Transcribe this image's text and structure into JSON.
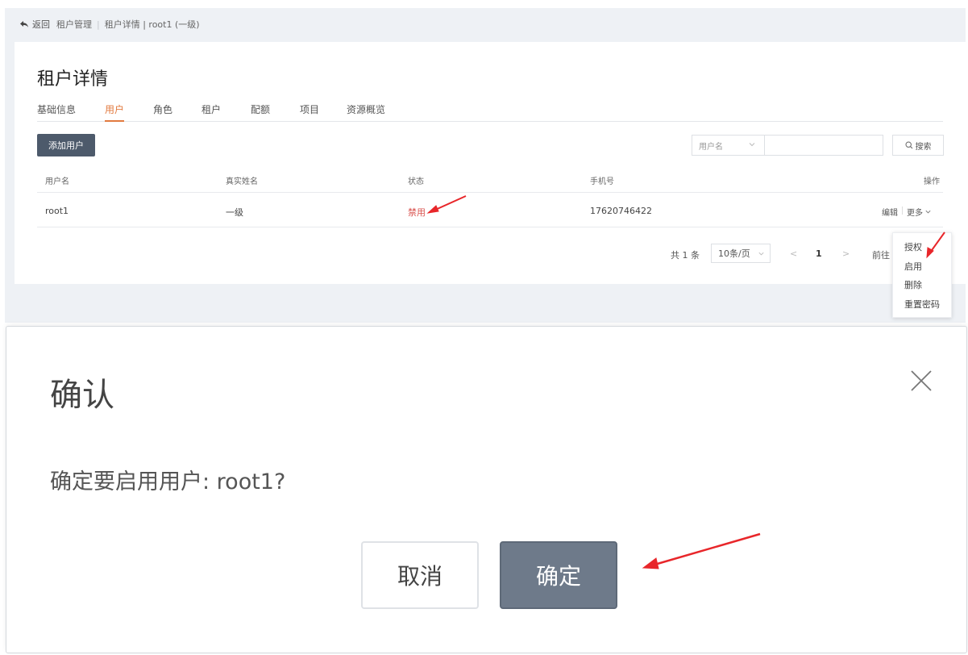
{
  "breadcrumb": {
    "back_label": "返回",
    "items": [
      "租户管理",
      "租户详情 | root1 (一级)"
    ]
  },
  "page_title": "租户详情",
  "tabs": [
    {
      "label": "基础信息",
      "active": false
    },
    {
      "label": "用户",
      "active": true
    },
    {
      "label": "角色",
      "active": false
    },
    {
      "label": "租户",
      "active": false
    },
    {
      "label": "配额",
      "active": false
    },
    {
      "label": "项目",
      "active": false
    },
    {
      "label": "资源概览",
      "active": false
    }
  ],
  "toolbar": {
    "add_user_label": "添加用户",
    "filter_field": "用户名",
    "search_value": "",
    "search_label": "搜索"
  },
  "table": {
    "headers": [
      "用户名",
      "真实姓名",
      "状态",
      "手机号",
      "操作"
    ],
    "rows": [
      {
        "username": "root1",
        "realname": "一级",
        "status": "禁用",
        "phone": "17620746422",
        "edit": "编辑",
        "more": "更多"
      }
    ]
  },
  "pagination": {
    "total": "共 1 条",
    "page_size": "10条/页",
    "prev": "<",
    "current": "1",
    "next": ">",
    "goto": "前往"
  },
  "more_menu": [
    "授权",
    "启用",
    "删除",
    "重置密码"
  ],
  "dialog": {
    "title": "确认",
    "message": "确定要启用用户: root1?",
    "cancel_label": "取消",
    "ok_label": "确定"
  },
  "colors": {
    "accent": "#e27a3f",
    "danger": "#d9534f",
    "primary_button": "#4d5a6b",
    "annotation_arrow": "#e8262a"
  }
}
